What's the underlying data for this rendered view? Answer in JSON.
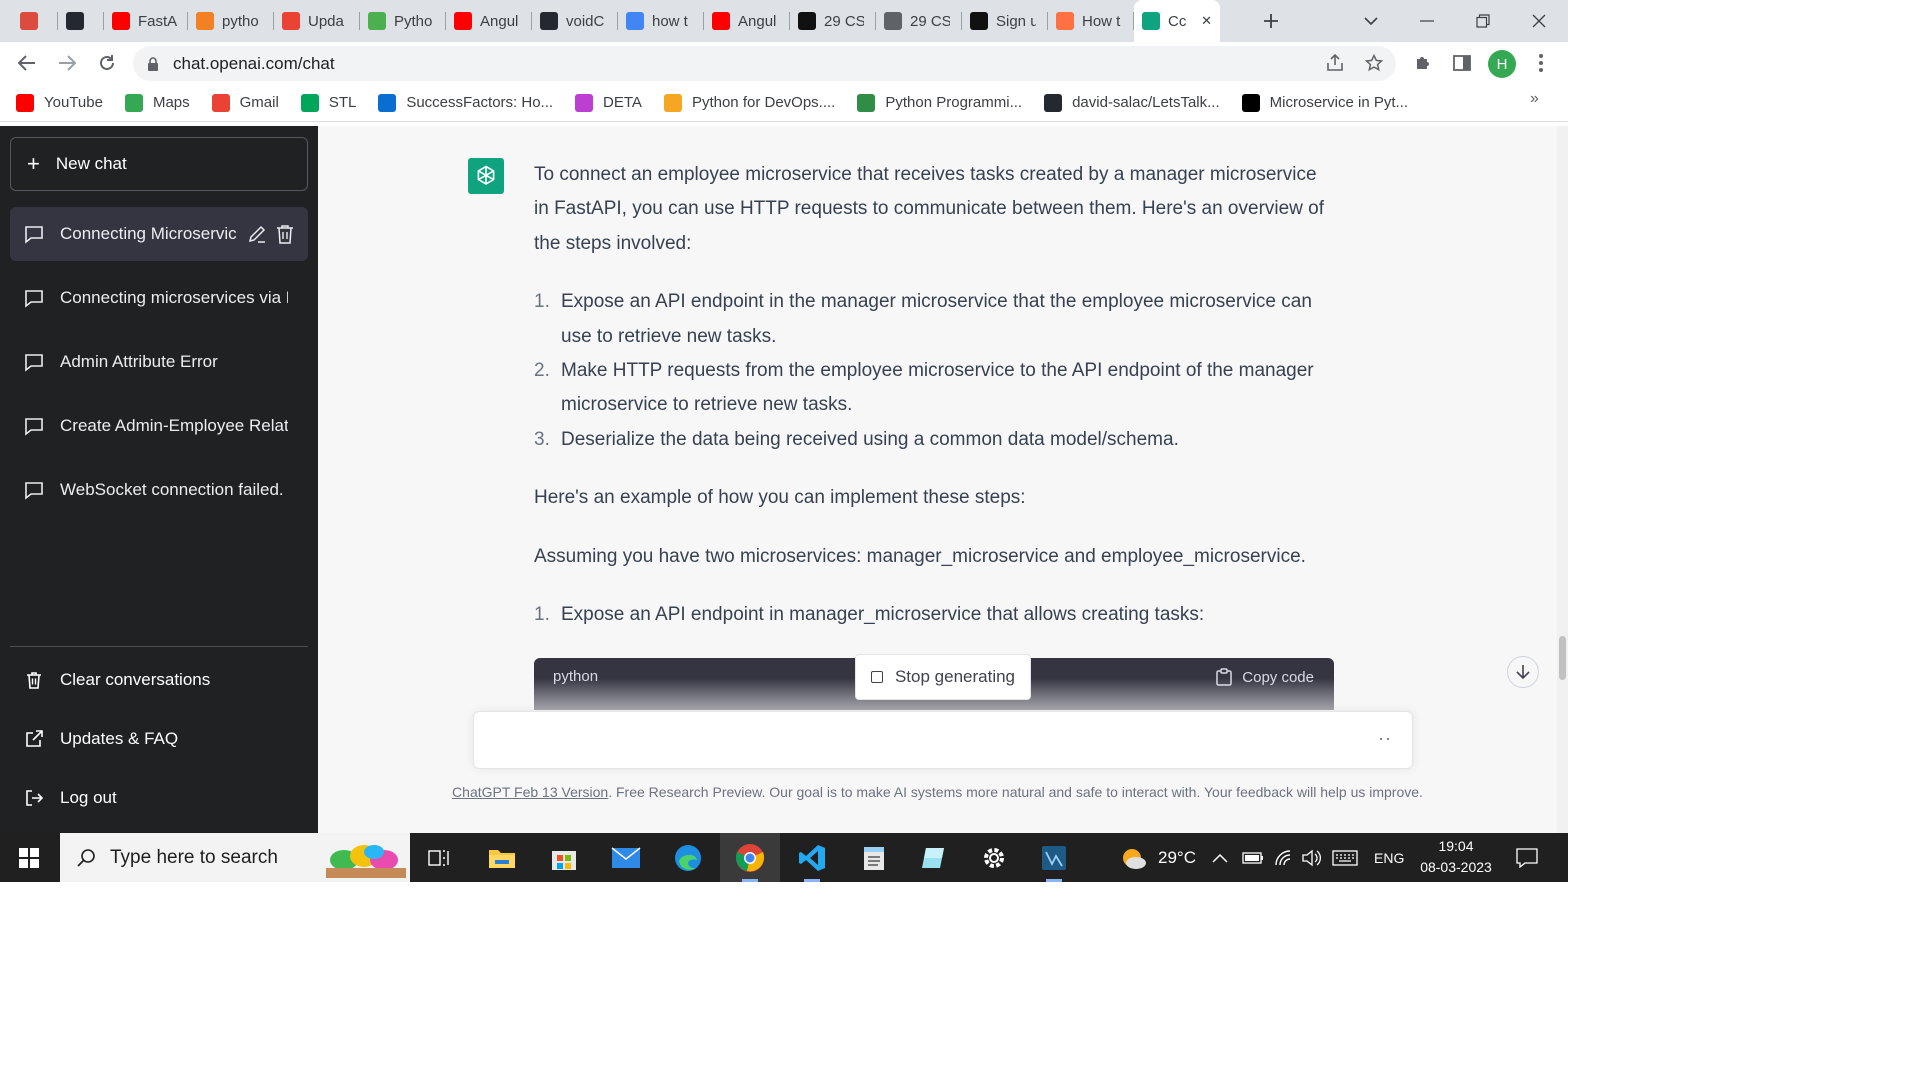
{
  "browser": {
    "tabs": [
      {
        "title": "",
        "icon": "todoist-icon",
        "color": "#db4c3f"
      },
      {
        "title": "",
        "icon": "github-icon",
        "color": "#24292f"
      },
      {
        "title": "FastAI",
        "icon": "youtube-icon",
        "color": "#ff0000"
      },
      {
        "title": "pytho",
        "icon": "stackoverflow-icon",
        "color": "#f48024"
      },
      {
        "title": "Upda",
        "icon": "gmail-icon",
        "color": "#ea4335"
      },
      {
        "title": "Pytho",
        "icon": "fi-icon",
        "color": "#4caf50"
      },
      {
        "title": "Angul",
        "icon": "youtube-icon",
        "color": "#ff0000"
      },
      {
        "title": "voidC",
        "icon": "github-icon",
        "color": "#24292f"
      },
      {
        "title": "how t",
        "icon": "google-icon",
        "color": "#4285f4"
      },
      {
        "title": "Angul",
        "icon": "youtube-icon",
        "color": "#ff0000"
      },
      {
        "title": "29 CS",
        "icon": "f-icon",
        "color": "#111111"
      },
      {
        "title": "29 CS",
        "icon": "globe-icon",
        "color": "#5f6368"
      },
      {
        "title": "Sign u",
        "icon": "codepen-icon",
        "color": "#111111"
      },
      {
        "title": "How t",
        "icon": "chat-bubble-icon",
        "color": "#ff7043"
      },
      {
        "title": "Cc",
        "icon": "openai-icon",
        "color": "#10a37f",
        "active": true
      }
    ],
    "url": "chat.openai.com/chat",
    "profile_initial": "H",
    "bookmarks": [
      {
        "label": "YouTube",
        "icon": "youtube-icon",
        "color": "#ff0000"
      },
      {
        "label": "Maps",
        "icon": "maps-icon",
        "color": "#34a853"
      },
      {
        "label": "Gmail",
        "icon": "gmail-icon",
        "color": "#ea4335"
      },
      {
        "label": "STL",
        "icon": "stl-icon",
        "color": "#00a65a"
      },
      {
        "label": "SuccessFactors: Ho...",
        "icon": "sf-icon",
        "color": "#0a6ed1"
      },
      {
        "label": "DETA",
        "icon": "deta-icon",
        "color": "#bd3fd1"
      },
      {
        "label": "Python for DevOps....",
        "icon": "co-icon",
        "color": "#f5a623"
      },
      {
        "label": "Python Programmi...",
        "icon": "gfg-icon",
        "color": "#2f8d46"
      },
      {
        "label": "david-salac/LetsTalk...",
        "icon": "github-icon",
        "color": "#24292f"
      },
      {
        "label": "Microservice in Pyt...",
        "icon": "dev-icon",
        "color": "#000000"
      }
    ],
    "overflow_label": "»"
  },
  "sidebar": {
    "new_chat": "New chat",
    "conversations": [
      {
        "title": "Connecting Microservic",
        "active": true
      },
      {
        "title": "Connecting microservices via F"
      },
      {
        "title": "Admin Attribute Error"
      },
      {
        "title": "Create Admin-Employee Relati"
      },
      {
        "title": "WebSocket connection failed."
      }
    ],
    "clear": "Clear conversations",
    "updates": "Updates & FAQ",
    "logout": "Log out"
  },
  "chat": {
    "intro": "To connect an employee microservice that receives tasks created by a manager microservice in FastAPI, you can use HTTP requests to communicate between them. Here's an overview of the steps involved:",
    "steps": [
      {
        "n": "1.",
        "text": "Expose an API endpoint in the manager microservice that the employee microservice can use to retrieve new tasks."
      },
      {
        "n": "2.",
        "text": "Make HTTP requests from the employee microservice to the API endpoint of the manager microservice to retrieve new tasks."
      },
      {
        "n": "3.",
        "text": "Deserialize the data being received using a common data model/schema."
      }
    ],
    "example_line": "Here's an example of how you can implement these steps:",
    "assume_line": "Assuming you have two microservices: manager_microservice and employee_microservice.",
    "step_detail": {
      "n": "1.",
      "text": "Expose an API endpoint in manager_microservice that allows creating tasks:"
    },
    "code_lang": "python",
    "copy_label": "Copy code",
    "stop_label": "Stop generating",
    "input_dots": "··",
    "footer_link": "ChatGPT Feb 13 Version",
    "footer_text": ". Free Research Preview. Our goal is to make AI systems more natural and safe to interact with. Your feedback will help us improve."
  },
  "taskbar": {
    "search_placeholder": "Type here to search",
    "weather": "29°C",
    "language": "ENG",
    "time": "19:04",
    "date": "08-03-2023"
  }
}
